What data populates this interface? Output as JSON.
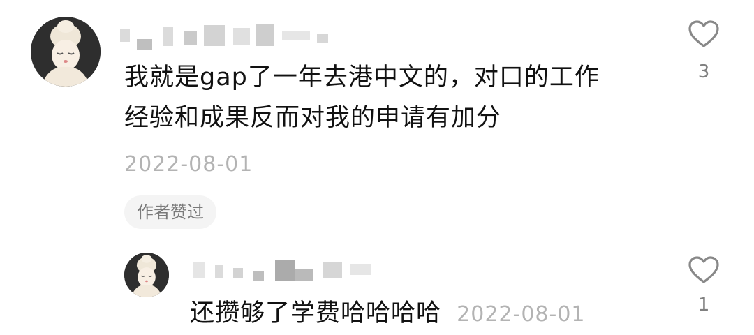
{
  "comments": [
    {
      "text_line1": "我就是gap了一年去港中文的，对口的工作",
      "text_line2": "经验和成果反而对我的申请有加分",
      "date": "2022-08-01",
      "badge": "作者赞过",
      "like_count": "3",
      "avatar_icon": "avatar-girl-towel-icon"
    },
    {
      "text": "还攒够了学费哈哈哈哈",
      "date": "2022-08-01",
      "like_count": "1",
      "avatar_icon": "avatar-girl-towel-icon"
    }
  ],
  "colors": {
    "text": "#111111",
    "muted": "#b3b3b3",
    "badge_bg": "#f4f4f4",
    "heart": "#888888"
  }
}
